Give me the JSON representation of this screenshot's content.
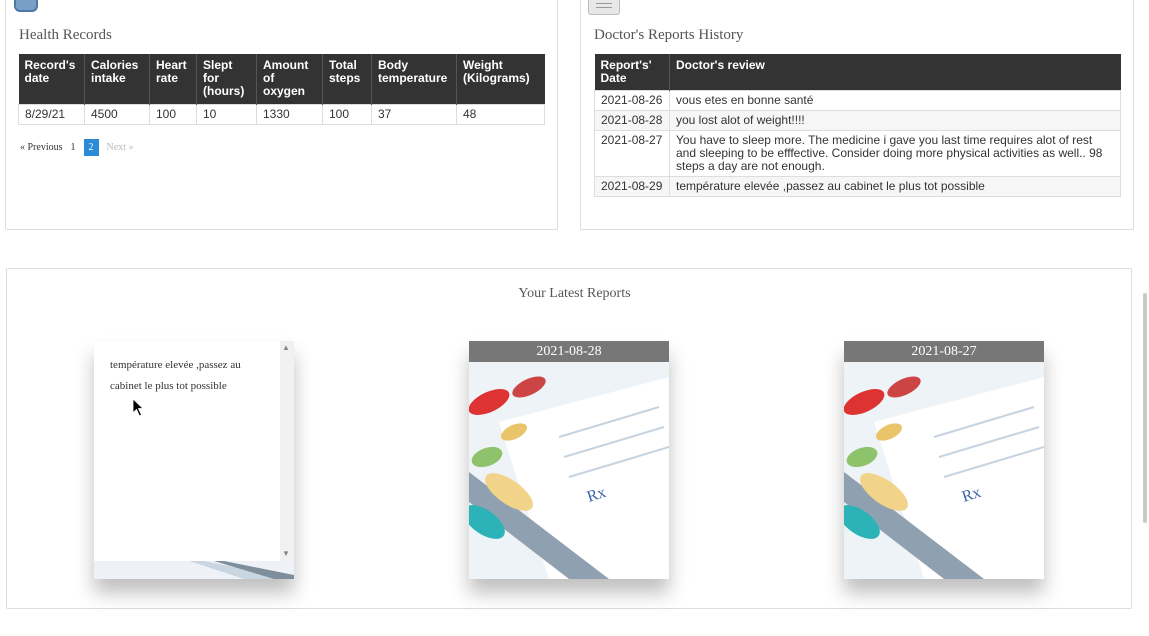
{
  "health": {
    "title": "Health Records",
    "headers": [
      "Record's date",
      "Calories intake",
      "Heart rate",
      "Slept for (hours)",
      "Amount of oxygen",
      "Total steps",
      "Body temperature",
      "Weight (Kilograms)"
    ],
    "rows": [
      [
        "8/29/21",
        "4500",
        "100",
        "10",
        "1330",
        "100",
        "37",
        "48"
      ]
    ],
    "pagination": {
      "previous": "« Previous",
      "page1": "1",
      "page2": "2",
      "next": "Next »"
    }
  },
  "doctor": {
    "title": "Doctor's Reports History",
    "headers": [
      "Report's' Date",
      "Doctor's review"
    ],
    "rows": [
      [
        "2021-08-26",
        "vous etes en bonne santé"
      ],
      [
        "2021-08-28",
        "you lost alot of weight!!!!"
      ],
      [
        "2021-08-27",
        "You have to sleep more. The medicine i gave you last time requires alot of rest and sleeping to be efffective. Consider doing more physical activities as well.. 98 steps a day are not enough."
      ],
      [
        "2021-08-29",
        "température elevée ,passez au cabinet le plus tot possible"
      ]
    ]
  },
  "latest": {
    "title": "Your Latest Reports",
    "cards": [
      {
        "text": "température elevée ,passez au cabinet le plus tot possible"
      },
      {
        "date": "2021-08-28"
      },
      {
        "date": "2021-08-27"
      }
    ]
  },
  "icons": {
    "health": "clipboard-icon",
    "doctor": "document-icon"
  },
  "colors": {
    "table_header": "#333333",
    "active_page": "#2a8cd8",
    "card_header": "#777777"
  }
}
